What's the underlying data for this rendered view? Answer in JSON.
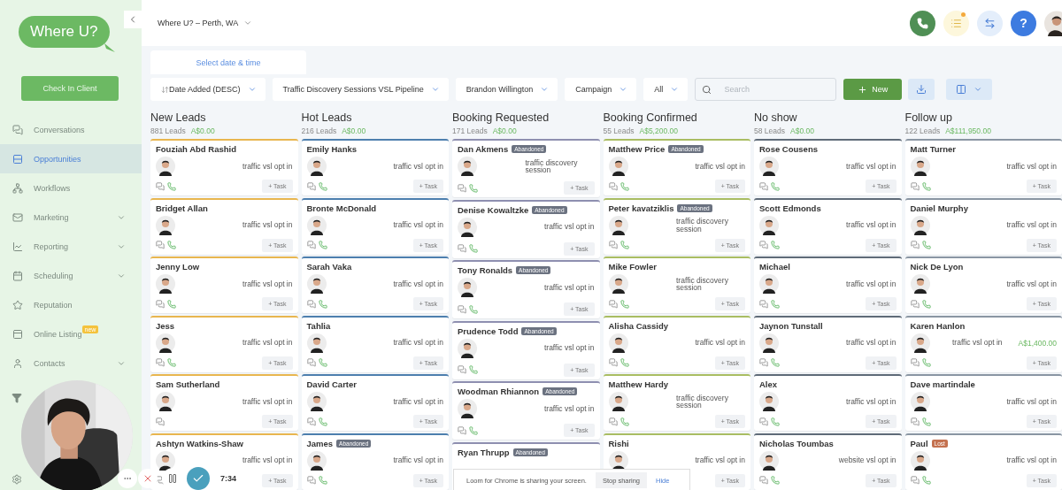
{
  "sidebar": {
    "logo": "Where U?",
    "check_in_button": "Check In Client",
    "items": [
      {
        "label": "Conversations",
        "selected": false,
        "has_submenu": false
      },
      {
        "label": "Opportunities",
        "selected": true,
        "has_submenu": false
      },
      {
        "label": "Workflows",
        "selected": false,
        "has_submenu": false
      },
      {
        "label": "Marketing",
        "selected": false,
        "has_submenu": true
      },
      {
        "label": "Reporting",
        "selected": false,
        "has_submenu": true
      },
      {
        "label": "Scheduling",
        "selected": false,
        "has_submenu": true
      },
      {
        "label": "Reputation",
        "selected": false,
        "has_submenu": false
      },
      {
        "label": "Online Listing",
        "selected": false,
        "has_submenu": false,
        "badge": "new"
      },
      {
        "label": "Contacts",
        "selected": false,
        "has_submenu": true
      }
    ]
  },
  "topbar": {
    "location": "Where U? – Perth, WA",
    "help": "?",
    "notification_dot": true
  },
  "tabs": [
    {
      "label": "Select date & time",
      "selected": true
    }
  ],
  "filters": [
    {
      "label": "Date Added (DESC)",
      "kind": "sort"
    },
    {
      "label": "Traffic Discovery Sessions VSL Pipeline",
      "kind": "dropdown"
    },
    {
      "label": "Brandon Willington",
      "kind": "dropdown"
    },
    {
      "label": "Campaign",
      "kind": "dropdown"
    },
    {
      "label": "All",
      "kind": "dropdown"
    }
  ],
  "search": {
    "placeholder": "Search"
  },
  "new_button": "New",
  "columns": [
    {
      "title": "New Leads",
      "count": "881 Leads",
      "amount": "A$0.00",
      "color": "#e8b64f",
      "cards": [
        {
          "name": "Fouziah Abd Rashid",
          "source": "traffic vsl opt in",
          "phone": true,
          "action": "+ Task"
        },
        {
          "name": "Bridget Allan",
          "source": "traffic vsl opt in",
          "phone": true,
          "action": "+ Task"
        },
        {
          "name": "Jenny Low",
          "source": "traffic vsl opt in",
          "phone": true,
          "action": "+ Task"
        },
        {
          "name": "Jess",
          "source": "traffic vsl opt in",
          "phone": true,
          "action": "+ Task"
        },
        {
          "name": "Sam Sutherland",
          "source": "traffic vsl opt in",
          "phone": false,
          "action": "+ Task"
        },
        {
          "name": "Ashtyn Watkins-Shaw",
          "source": "traffic vsl opt in",
          "phone": false,
          "action": "+ Task"
        }
      ]
    },
    {
      "title": "Hot Leads",
      "count": "216 Leads",
      "amount": "A$0.00",
      "color": "#4d7fae",
      "cards": [
        {
          "name": "Emily Hanks",
          "source": "traffic vsl opt in",
          "phone": true,
          "action": "+ Task"
        },
        {
          "name": "Bronte McDonald",
          "source": "traffic vsl opt in",
          "phone": true,
          "action": "+ Task"
        },
        {
          "name": "Sarah Vaka",
          "source": "traffic vsl opt in",
          "phone": true,
          "action": "+ Task"
        },
        {
          "name": "Tahlia",
          "source": "traffic vsl opt in",
          "phone": true,
          "action": "+ Task"
        },
        {
          "name": "David Carter",
          "source": "traffic vsl opt in",
          "phone": true,
          "action": "+ Task"
        },
        {
          "name": "James",
          "badge": {
            "label": "Abandoned",
            "color": "#6b7280"
          },
          "source": "traffic vsl opt in",
          "phone": true,
          "action": "+ Task"
        }
      ]
    },
    {
      "title": "Booking Requested",
      "count": "171 Leads",
      "amount": "A$0.00",
      "color": "#8e8fb0",
      "cards": [
        {
          "name": "Dan Akmens",
          "badge": {
            "label": "Abandoned",
            "color": "#6b7280"
          },
          "source": "traffic discovery session",
          "phone": true,
          "action": "+ Task"
        },
        {
          "name": "Denise Kowaltzke",
          "badge": {
            "label": "Abandoned",
            "color": "#6b7280"
          },
          "source": "traffic vsl opt in",
          "phone": true,
          "action": "+ Task"
        },
        {
          "name": "Tony Ronalds",
          "badge": {
            "label": "Abandoned",
            "color": "#6b7280"
          },
          "source": "traffic vsl opt in",
          "phone": true,
          "action": "+ Task"
        },
        {
          "name": "Prudence Todd",
          "badge": {
            "label": "Abandoned",
            "color": "#6b7280"
          },
          "source": "traffic vsl opt in",
          "phone": true,
          "action": "+ Task"
        },
        {
          "name": "Woodman Rhiannon",
          "badge": {
            "label": "Abandoned",
            "color": "#6b7280"
          },
          "source": "traffic vsl opt in",
          "phone": true,
          "action": "+ Task"
        },
        {
          "name": "Ryan Thrupp",
          "badge": {
            "label": "Abandoned",
            "color": "#6b7280"
          }
        }
      ]
    },
    {
      "title": "Booking Confirmed",
      "count": "55 Leads",
      "amount": "A$5,200.00",
      "color": "#a9bd62",
      "cards": [
        {
          "name": "Matthew Price",
          "badge": {
            "label": "Abandoned",
            "color": "#6b7280"
          },
          "source": "traffic vsl opt in",
          "phone": true,
          "action": "+ Task"
        },
        {
          "name": "Peter kavatziklis",
          "badge": {
            "label": "Abandoned",
            "color": "#6b7280"
          },
          "source": "traffic discovery session",
          "phone": true,
          "action": "+ Task"
        },
        {
          "name": "Mike Fowler",
          "source": "traffic discovery session",
          "phone": true,
          "action": "+ Task"
        },
        {
          "name": "Alisha Cassidy",
          "source": "traffic vsl opt in",
          "phone": true,
          "action": "+ Task"
        },
        {
          "name": "Matthew Hardy",
          "source": "traffic discovery session",
          "phone": true,
          "action": "+ Task"
        },
        {
          "name": "Rishi",
          "source": "traffic vsl opt in",
          "phone": false,
          "action": "+ Task"
        }
      ]
    },
    {
      "title": "No show",
      "count": "58 Leads",
      "amount": "A$0.00",
      "color": "#5f6b78",
      "cards": [
        {
          "name": "Rose Cousens",
          "source": "traffic vsl opt in",
          "phone": true,
          "action": "+ Task"
        },
        {
          "name": "Scott Edmonds",
          "source": "traffic vsl opt in",
          "phone": true,
          "action": "+ Task"
        },
        {
          "name": "Michael",
          "source": "traffic vsl opt in",
          "phone": true,
          "action": "+ Task"
        },
        {
          "name": "Jaynon Tunstall",
          "source": "traffic vsl opt in",
          "phone": true,
          "action": "+ Task"
        },
        {
          "name": "Alex",
          "source": "traffic vsl opt in",
          "phone": true,
          "action": "+ Task"
        },
        {
          "name": "Nicholas Toumbas",
          "source": "website vsl opt in",
          "phone": true,
          "action": "+ Task"
        }
      ]
    },
    {
      "title": "Follow up",
      "count": "122 Leads",
      "amount": "A$111,950.00",
      "color": "#8a96a3",
      "cards": [
        {
          "name": "Matt Turner",
          "source": "traffic vsl opt in",
          "phone": true,
          "action": "+ Task"
        },
        {
          "name": "Daniel Murphy",
          "source": "traffic vsl opt in",
          "phone": true,
          "action": "+ Task"
        },
        {
          "name": "Nick De Lyon",
          "source": "traffic vsl opt in",
          "phone": true,
          "action": "+ Task"
        },
        {
          "name": "Karen Hanlon",
          "source": "traffic vsl opt in",
          "value": "A$1,400.00",
          "phone": true,
          "action": "+ Task"
        },
        {
          "name": "Dave martindale",
          "source": "traffic vsl opt in",
          "phone": true,
          "action": "+ Task"
        },
        {
          "name": "Paul",
          "badge": {
            "label": "Lost",
            "color": "#c4714f"
          },
          "source": "traffic vsl opt in",
          "phone": true,
          "action": "+ Task"
        }
      ]
    }
  ],
  "recorder": {
    "timer": "7:34",
    "banner": "Loom for Chrome is sharing your screen.",
    "stop_button": "Stop sharing",
    "hide_link": "Hide"
  }
}
